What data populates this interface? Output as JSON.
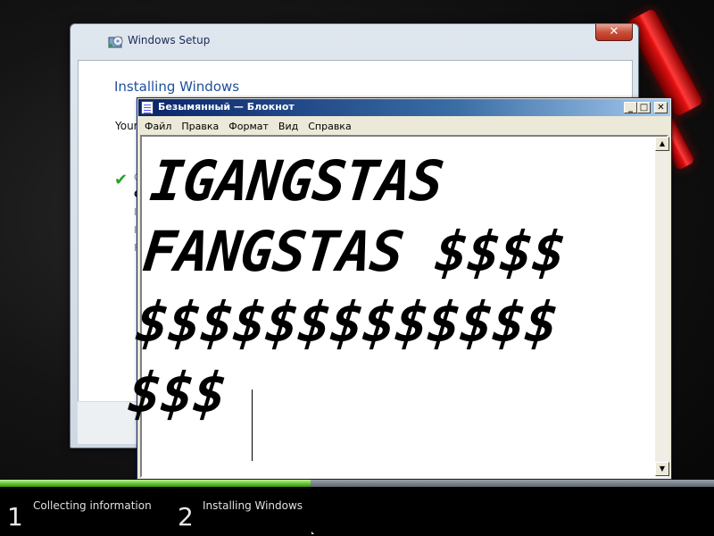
{
  "setup": {
    "title": "Windows Setup",
    "close_label": "✕",
    "heading": "Installing Windows",
    "subtext": "Your",
    "steps": [
      {
        "label": "C",
        "status": "done"
      },
      {
        "label": "C",
        "status": "current"
      },
      {
        "label": "I",
        "status": "pending"
      },
      {
        "label": "I",
        "status": "pending"
      },
      {
        "label": "F",
        "status": "pending"
      }
    ]
  },
  "notepad": {
    "title": "Безымянный — Блокнот",
    "buttons": {
      "minimize": "_",
      "maximize": "□",
      "close": "✕"
    },
    "menu": [
      "Файл",
      "Правка",
      "Формат",
      "Вид",
      "Справка"
    ],
    "text_lines": [
      "IGANGSTAS",
      "FANGSTAS $$$$",
      "$$$$$$$$$$$$$",
      "$$$"
    ],
    "scroll_up": "▲",
    "scroll_down": "▼"
  },
  "progress": {
    "completed_fraction": 0.435
  },
  "stages": [
    {
      "number": "1",
      "label": "Collecting information"
    },
    {
      "number": "2",
      "label": "Installing Windows"
    }
  ],
  "colors": {
    "accent_red": "#e01010",
    "progress_green": "#5cbf2a",
    "heading_blue": "#1e4f9c",
    "notepad_title_blue": "#0a246a"
  }
}
